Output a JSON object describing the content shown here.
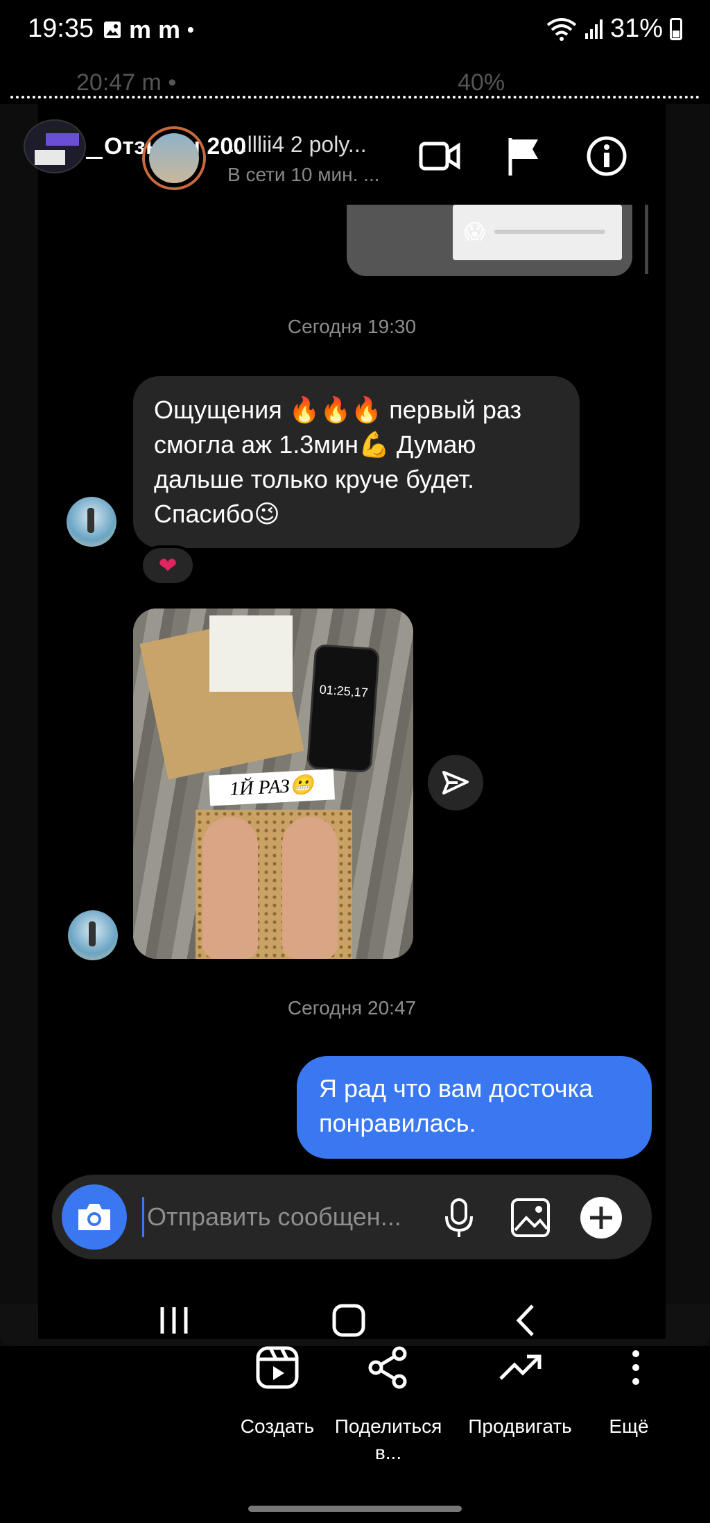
{
  "status_bar": {
    "time": "19:35",
    "indicators": "m m",
    "dot": "•",
    "battery": "31%",
    "icons": [
      "image-icon",
      "wifi-icon",
      "signal-icon",
      "battery-icon"
    ]
  },
  "inner_status_bar": {
    "time": "20:47",
    "indicators": "m •",
    "battery": "40%"
  },
  "story": {
    "title": "Отзывы 200"
  },
  "chat_header": {
    "name": "...lllii4 2 poly...",
    "status": "В сети 10 мин. ...",
    "icons": [
      "video-call-icon",
      "flag-icon",
      "info-icon"
    ]
  },
  "audio_snippet": {
    "emoji": "😱"
  },
  "messages": {
    "timestamp_1": "Сегодня 19:30",
    "received_text_1": "Ощущения 🔥🔥🔥 первый раз смогла аж 1.3мин💪 Думаю дальше только круче будет. Спасибо😉",
    "reaction": "❤",
    "image_caption": "1Й РАЗ😬",
    "image_phone_time": "01:25,17",
    "timestamp_2": "Сегодня 20:47",
    "sent_text_1": "Я рад что вам досточка понравилась."
  },
  "composer": {
    "placeholder": "Отправить сообщен..."
  },
  "actions": [
    {
      "label": "Создать",
      "icon": "reels-icon"
    },
    {
      "label": "Поделиться в...",
      "icon": "share-icon"
    },
    {
      "label": "Продвигать",
      "icon": "trending-icon"
    },
    {
      "label": "Ещё",
      "icon": "more-icon"
    }
  ],
  "colors": {
    "accent_blue": "#3a78f2",
    "bubble_dark": "#262626",
    "timestamp_gray": "#8e8e8e",
    "reaction_red": "#e0245e"
  }
}
